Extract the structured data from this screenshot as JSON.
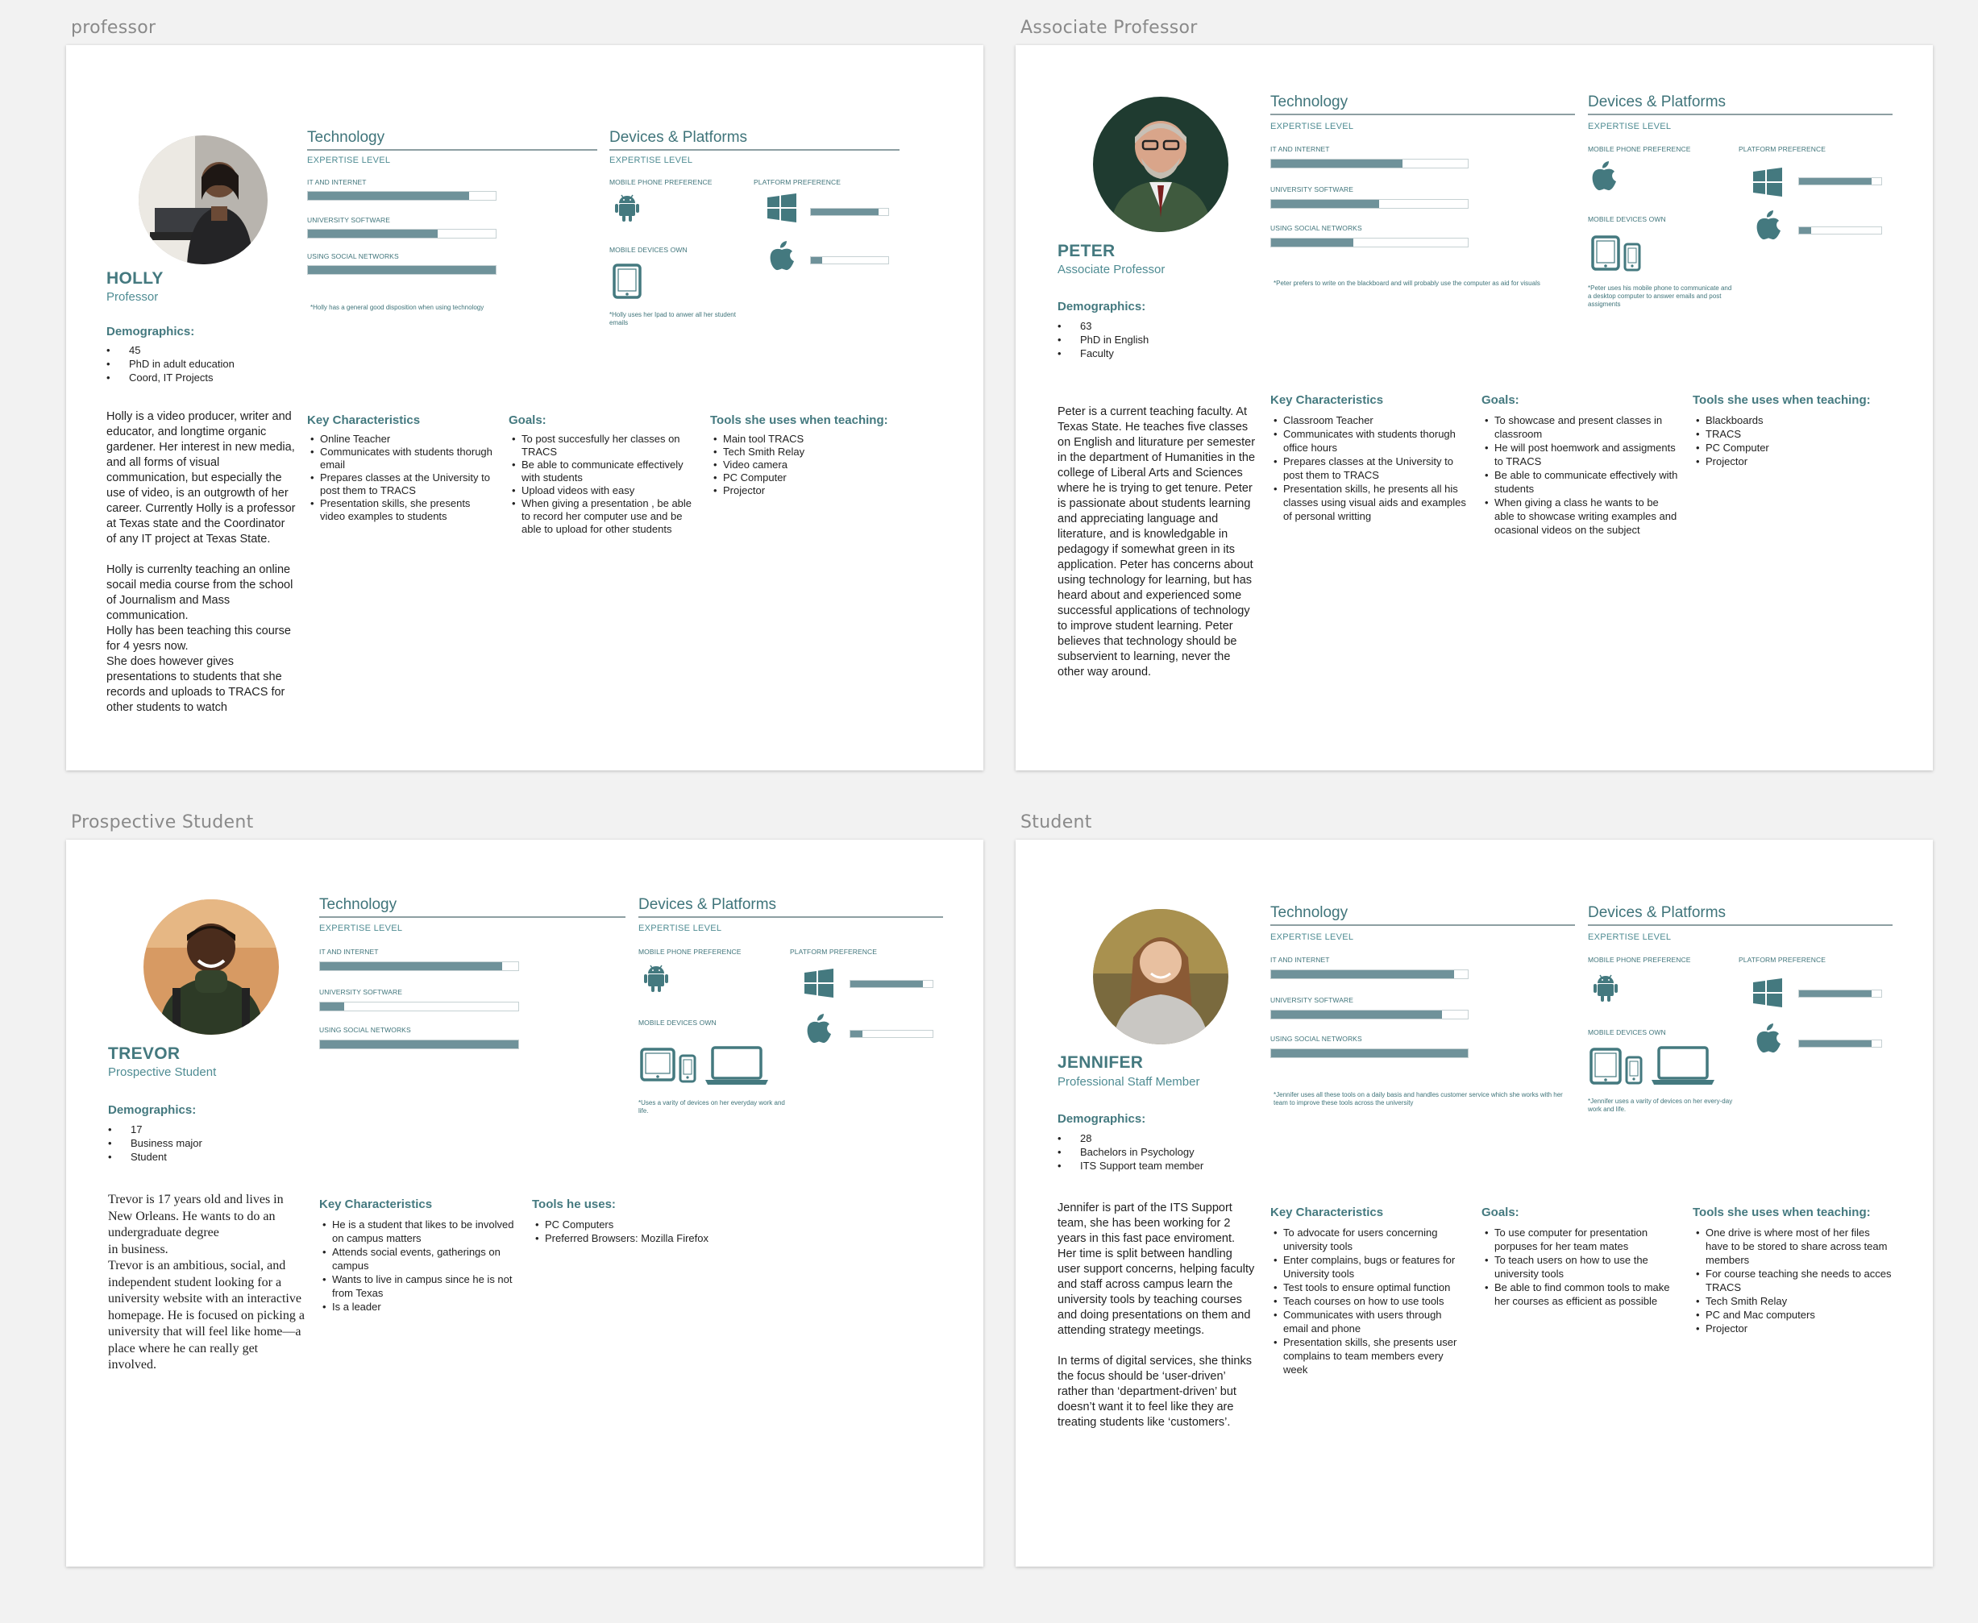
{
  "artboards": {
    "professor": "professor",
    "associate": "Associate Professor",
    "prospective": "Prospective Student",
    "student": "Student"
  },
  "common": {
    "technology": "Technology",
    "devices": "Devices & Platforms",
    "expertise": "EXPERTISE LEVEL",
    "it_internet": "IT AND INTERNET",
    "univ_software": "UNIVERSITY SOFTWARE",
    "social": "USING SOCIAL NETWORKS",
    "mobile_pref": "MOBILE PHONE PREFERENCE",
    "platform_pref": "PLATFORM PREFERENCE",
    "mobile_own": "MOBILE DEVICES OWN",
    "demographics": "Demographics:",
    "key_char": "Key Characteristics",
    "goals": "Goals:",
    "accent_color": "#44797f",
    "bar_color": "#6f929a"
  },
  "holly": {
    "name": "HOLLY",
    "role": "Professor",
    "demographics": [
      "45",
      "PhD in adult education",
      "Coord, IT Projects"
    ],
    "bio": "Holly  is a video producer, writer and educator, and longtime organic gardener. Her interest in new media, and all forms of visual communication, but especially the use of video, is an outgrowth of her career. Currently Holly is a professor at Texas state and the Coordinator of any IT project at Texas State.\n\nHolly is currenlty teaching an online socail media course from the school of Journalism and Mass communication.\nHolly has been teaching this course for 4 yesrs now.\nShe does however gives presentations to students that she records and uploads to TRACS for other students to watch",
    "tech_levels": {
      "it_internet": 0.86,
      "univ_software": 0.69,
      "social": 1.0
    },
    "tech_note": "*Holly has a general good disposition when using technology",
    "device_note": "*Holly uses her Ipad to anwer all her student emails",
    "mobile_pref_icon": "android-icon",
    "devices_own_icons": [
      "tablet-icon"
    ],
    "platform_levels": {
      "windows": 0.88,
      "apple": 0.15
    },
    "key_characteristics": [
      "Online Teacher",
      "Communicates with students thorugh email",
      "Prepares classes at the University to post them to TRACS",
      "Presentation skills, she presents video examples to students"
    ],
    "goals": [
      "To post succesfully her classes on TRACS",
      "Be able to communicate effectively with students",
      "Upload videos with easy",
      "When giving a presentation , be able to record her computer use and be able to upload for other students"
    ],
    "tools_title": "Tools she uses when teaching:",
    "tools": [
      "Main tool TRACS",
      "Tech Smith Relay",
      "Video camera",
      "PC Computer",
      "Projector"
    ]
  },
  "peter": {
    "name": "PETER",
    "role": "Associate Professor",
    "demographics": [
      "63",
      "PhD in English",
      "Faculty"
    ],
    "bio": "Peter is a current teaching faculty. At Texas State. He teaches five classes on English and liturature per semester in the department of Humanities in the college of Liberal Arts and Sciences where he is trying to get tenure. Peter is passionate about students learning and appreciating language and literature, and is knowledgable in pedagogy if somewhat green in its application. Peter has concerns about using technology for learning, but has heard about and experienced some successful applications of technology to improve student learning. Peter believes that technology should be subservient to learning, never the other way around.",
    "tech_levels": {
      "it_internet": 0.67,
      "univ_software": 0.55,
      "social": 0.42
    },
    "tech_note": "*Peter prefers to write on the blackboard and will probably use the computer as aid for visuals",
    "device_note": "*Peter uses his mobile phone to communicate and a desktop computer to answer emails and post assigments",
    "mobile_pref_icon": "apple-icon",
    "devices_own_icons": [
      "tablet-icon",
      "phone-icon"
    ],
    "platform_levels": {
      "windows": 0.88,
      "apple": 0.15
    },
    "key_characteristics": [
      "Classroom Teacher",
      "Communicates with students thorugh office hours",
      "Prepares classes at the University to post them to TRACS",
      "Presentation skills, he presents all his classes using visual aids and examples of personal writting"
    ],
    "goals": [
      "To showcase and present classes in classroom",
      "He will post hoemwork and assigments to  TRACS",
      "Be able to communicate effectively with students",
      "When giving a class he wants to be able to showcase writing examples and ocasional videos on the subject"
    ],
    "tools_title": "Tools she uses when teaching:",
    "tools": [
      "Blackboards",
      "TRACS",
      "PC Computer",
      "Projector"
    ]
  },
  "trevor": {
    "name": "TREVOR",
    "role": "Prospective Student",
    "demographics": [
      "17",
      "Business major",
      "Student"
    ],
    "bio": "Trevor is 17 years old and lives in New Orleans. He wants to do an undergraduate degree\nin business.\nTrevor is an ambitious, social, and independent student looking for a university website with an interactive homepage. He is focused on picking a university that will feel like home—a place where he can really get involved.",
    "tech_levels": {
      "it_internet": 0.92,
      "univ_software": 0.12,
      "social": 1.0
    },
    "device_note": "*Uses a varity of devices on her everyday work and life.",
    "mobile_pref_icon": "android-icon",
    "devices_own_icons": [
      "tablet-icon",
      "phone-icon",
      "laptop-icon"
    ],
    "platform_levels": {
      "windows": 0.88,
      "apple": 0.15
    },
    "key_characteristics": [
      "He is a student that likes to be involved on campus matters",
      "Attends social events, gatherings on campus",
      "Wants to live in campus since he is not from Texas",
      "Is a leader"
    ],
    "tools_title": "Tools he uses:",
    "tools": [
      "PC Computers",
      "Preferred Browsers: Mozilla Firefox"
    ]
  },
  "jennifer": {
    "name": "JENNIFER",
    "role": "Professional Staff Member",
    "demographics": [
      "28",
      "Bachelors in Psychology",
      "ITS Support team member"
    ],
    "bio": "Jennifer is part of the ITS Support team, she has been working for 2 years in this fast pace enviroment. Her time is split between handling user support concerns, helping faculty and staff across campus learn the university tools by teaching courses and doing presentations on them and attending strategy meetings.\n\nIn terms of digital services, she thinks the focus should be ‘user-driven’ rather than ‘department-driven’ but doesn’t want it to feel like they are treating students like ‘customers’.",
    "tech_levels": {
      "it_internet": 0.93,
      "univ_software": 0.87,
      "social": 1.0
    },
    "tech_note": "*Jennifer uses all these tools on a daily basis and handles customer service which she works with her team to improve these tools across the university",
    "device_note": "*Jennifer uses a varity of devices on her every-day work and life.",
    "mobile_pref_icon": "android-icon",
    "devices_own_icons": [
      "tablet-icon",
      "phone-icon",
      "laptop-icon"
    ],
    "platform_levels": {
      "windows": 0.88,
      "apple": 0.88
    },
    "key_characteristics": [
      "To advocate for users concerning university tools",
      "Enter complains, bugs or features for University tools",
      "Test tools to ensure optimal function",
      "Teach courses on how to use tools",
      "Communicates with users through email and phone",
      "Presentation skills, she presents user complains to team members every week"
    ],
    "goals": [
      "To use computer for presentation porpuses for her team mates",
      "To teach users on how to use the university tools",
      "Be able to find common tools to make her courses as efficient as possible"
    ],
    "tools_title": "Tools she uses when teaching:",
    "tools": [
      "One drive is where most of her files have to be stored to share across team members",
      "For course teaching she needs to acces  TRACS",
      "Tech Smith Relay",
      "PC  and Mac computers",
      "Projector"
    ]
  }
}
